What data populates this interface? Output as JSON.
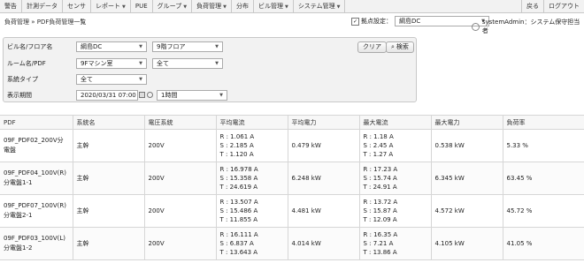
{
  "nav": {
    "items": [
      {
        "label": "警告",
        "dropdown": false
      },
      {
        "label": "計測データ",
        "dropdown": false
      },
      {
        "label": "センサ",
        "dropdown": false
      },
      {
        "label": "レポート",
        "dropdown": true
      },
      {
        "label": "PUE",
        "dropdown": false
      },
      {
        "label": "グループ",
        "dropdown": true
      },
      {
        "label": "負荷管理",
        "dropdown": true
      },
      {
        "label": "分布",
        "dropdown": false
      },
      {
        "label": "ビル管理",
        "dropdown": true
      },
      {
        "label": "システム管理",
        "dropdown": true
      }
    ],
    "back": "戻る",
    "logout": "ログアウト"
  },
  "breadcrumb": "負荷管理 » PDF負荷管理一覧",
  "site": {
    "label": "拠点設定：",
    "value": "綱島DC"
  },
  "user": "systemAdmin：システム保守担当者",
  "filters": {
    "building_label": "ビル名/フロア名",
    "building_value": "綱島DC",
    "floor_value": "9階フロア",
    "room_label": "ルーム名/PDF",
    "room_value": "9Fマシン室",
    "pdf_value": "全て",
    "system_label": "系統タイプ",
    "system_value": "全て",
    "period_label": "表示期間",
    "date_value": "2020/03/31 07:00",
    "range_value": "1時間",
    "clear_label": "クリア",
    "search_label": "検索"
  },
  "table": {
    "headers": [
      "PDF",
      "系統名",
      "電圧系統",
      "平均電流",
      "平均電力",
      "最大電流",
      "最大電力",
      "負荷率"
    ],
    "rows": [
      {
        "pdf": "09F_PDF02_200V分電盤",
        "system": "主幹",
        "voltage": "200V",
        "avg_r": "R : 1.061 A",
        "avg_s": "S : 2.185 A",
        "avg_t": "T : 1.120 A",
        "avg_power": "0.479 kW",
        "max_r": "R : 1.18 A",
        "max_s": "S : 2.45 A",
        "max_t": "T : 1.27 A",
        "max_power": "0.538 kW",
        "load": "5.33 %"
      },
      {
        "pdf": "09F_PDF04_100V(R)分電盤1-1",
        "system": "主幹",
        "voltage": "200V",
        "avg_r": "R : 16.978 A",
        "avg_s": "S : 15.358 A",
        "avg_t": "T : 24.619 A",
        "avg_power": "6.248 kW",
        "max_r": "R : 17.23 A",
        "max_s": "S : 15.74 A",
        "max_t": "T : 24.91 A",
        "max_power": "6.345 kW",
        "load": "63.45 %"
      },
      {
        "pdf": "09F_PDF07_100V(R)分電盤2-1",
        "system": "主幹",
        "voltage": "200V",
        "avg_r": "R : 13.507 A",
        "avg_s": "S : 15.486 A",
        "avg_t": "T : 11.855 A",
        "avg_power": "4.481 kW",
        "max_r": "R : 13.72 A",
        "max_s": "S : 15.87 A",
        "max_t": "T : 12.09 A",
        "max_power": "4.572 kW",
        "load": "45.72 %"
      },
      {
        "pdf": "09F_PDF03_100V(L)分電盤1-2",
        "system": "主幹",
        "voltage": "200V",
        "avg_r": "R : 16.111 A",
        "avg_s": "S : 6.837 A",
        "avg_t": "T : 13.643 A",
        "avg_power": "4.014 kW",
        "max_r": "R : 16.35 A",
        "max_s": "S : 7.21 A",
        "max_t": "T : 13.86 A",
        "max_power": "4.105 kW",
        "load": "41.05 %"
      }
    ]
  }
}
